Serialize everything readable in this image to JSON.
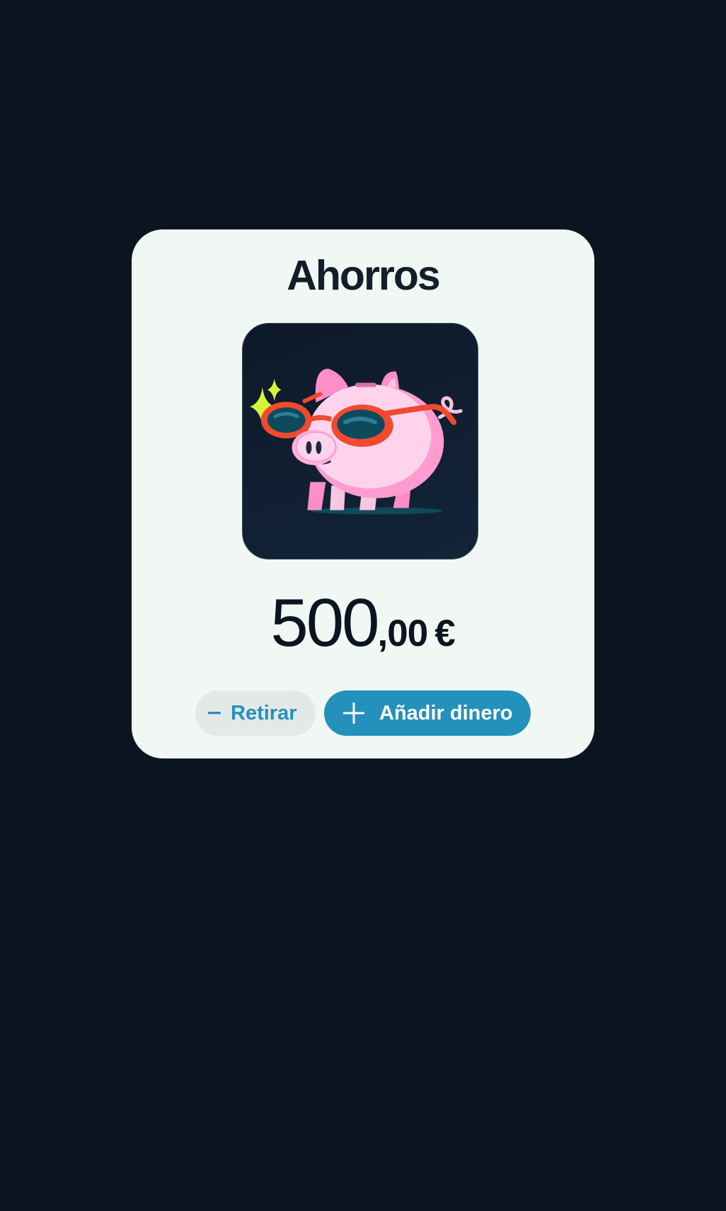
{
  "card": {
    "title": "Ahorros",
    "illustration_icon": "piggy-bank-with-sunglasses-icon",
    "balance": {
      "integer": "500",
      "decimals": ",00",
      "currency": "€"
    },
    "actions": {
      "withdraw_label": "Retirar",
      "withdraw_icon": "minus-icon",
      "add_label": "Añadir dinero",
      "add_icon": "plus-icon"
    }
  },
  "colors": {
    "background": "#0a1520",
    "card": "#f1f7f3",
    "accent": "#2490bc",
    "secondary_button": "#e3e9e6",
    "text_dark": "#121e2a"
  }
}
